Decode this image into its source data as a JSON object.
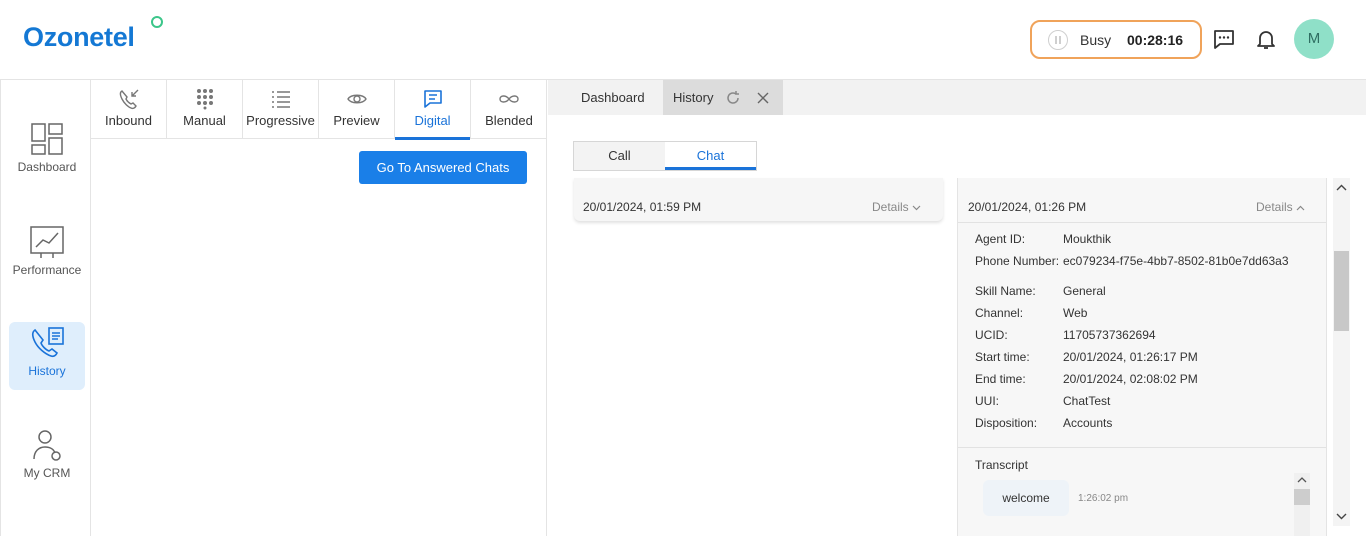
{
  "header": {
    "logo_text": "Ozonetel",
    "status": {
      "label": "Busy",
      "timer": "00:28:16"
    },
    "avatar_initial": "M"
  },
  "leftnav": {
    "items": [
      {
        "label": "Dashboard",
        "icon": "dashboard-icon"
      },
      {
        "label": "Performance",
        "icon": "performance-icon"
      },
      {
        "label": "History",
        "icon": "history-icon",
        "active": true
      },
      {
        "label": "My CRM",
        "icon": "crm-icon"
      }
    ]
  },
  "modes": {
    "tabs": [
      {
        "label": "Inbound",
        "icon": "inbound-call-icon"
      },
      {
        "label": "Manual",
        "icon": "dialpad-icon"
      },
      {
        "label": "Progressive",
        "icon": "list-icon"
      },
      {
        "label": "Preview",
        "icon": "eye-icon"
      },
      {
        "label": "Digital",
        "icon": "chat-icon",
        "active": true
      },
      {
        "label": "Blended",
        "icon": "infinity-icon"
      }
    ],
    "go_button": "Go To Answered Chats"
  },
  "page_tabs": {
    "dashboard": "Dashboard",
    "history": "History"
  },
  "subtabs": {
    "call": "Call",
    "chat": "Chat",
    "active": "Chat"
  },
  "card1": {
    "date": "20/01/2024, 01:59 PM",
    "details": "Details"
  },
  "card2": {
    "date": "20/01/2024, 01:26 PM",
    "details": "Details",
    "fields": [
      {
        "key": "Agent ID:",
        "value": "Moukthik"
      },
      {
        "key": "Phone Number:",
        "value": "ec079234-f75e-4bb7-8502-81b0e7dd63a3"
      },
      {
        "key": "Skill Name:",
        "value": "General"
      },
      {
        "key": "Channel:",
        "value": "Web"
      },
      {
        "key": "UCID:",
        "value": "11705737362694"
      },
      {
        "key": "Start time:",
        "value": "20/01/2024, 01:26:17 PM"
      },
      {
        "key": "End time:",
        "value": "20/01/2024, 02:08:02 PM"
      },
      {
        "key": "UUI:",
        "value": "ChatTest"
      },
      {
        "key": "Disposition:",
        "value": "Accounts"
      }
    ],
    "transcript_label": "Transcript",
    "message": {
      "text": "welcome",
      "time": "1:26:02 pm"
    }
  },
  "colors": {
    "accent": "#1a73d9",
    "busy_border": "#f0a35a",
    "avatar_bg": "#8fe0c8",
    "logo": "#1478d4"
  }
}
